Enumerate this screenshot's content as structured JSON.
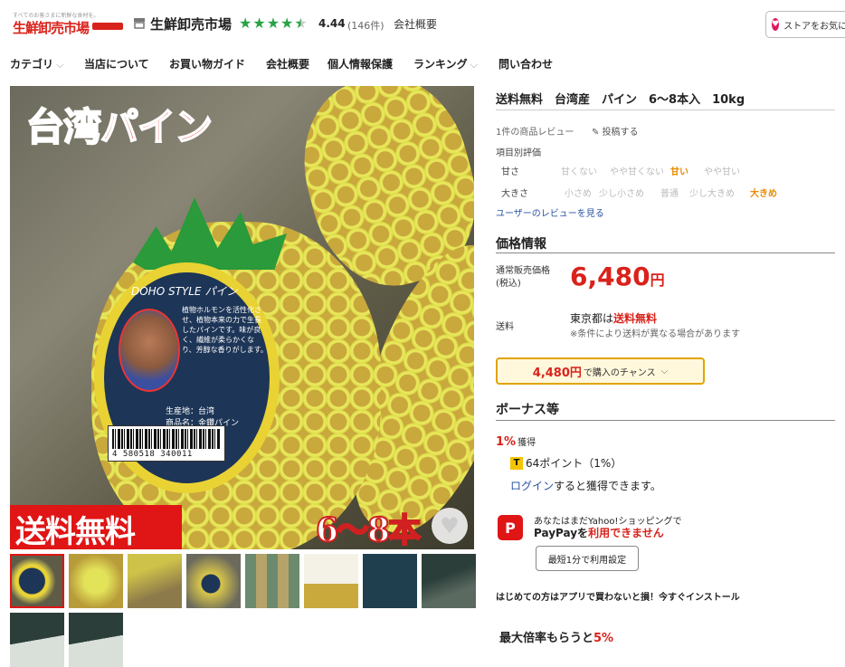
{
  "header": {
    "logo_tagline": "すべてのお客さまに新鮮な食材を。",
    "logo_text": "生鮮卸売市場",
    "store_name": "生鮮卸売市場",
    "rating": "4.44",
    "rating_count": "(146件)",
    "company_overview": "会社概要",
    "favorite_button": "ストアをお気に入り"
  },
  "nav": {
    "category": "カテゴリ",
    "about": "当店について",
    "guide": "お買い物ガイド",
    "overview": "会社概要",
    "privacy": "個人情報保護",
    "ranking": "ランキング",
    "contact": "問い合わせ"
  },
  "image": {
    "title": "台湾パイン",
    "label_title": "DOHO STYLE パイン",
    "label_text": "植物ホルモンを活性化させ、植物本来の力で生長したパインです。味が良く、繊維が柔らかくなり、芳醇な香りがします。",
    "label_origin": "生産地：台湾",
    "label_product": "商品名：金鑽パイン",
    "barcode": "4 580518 340011",
    "shipping_banner": "送料無料",
    "quantity": "6〜8本"
  },
  "product": {
    "title": "送料無料　台湾産　パイン　6〜8本入　10kg",
    "review_count": "1件の商品レビュー",
    "post_review": "投稿する",
    "rating_by_item": "項目別評価",
    "sweetness_label": "甘さ",
    "sweetness_options": [
      "甘くない",
      "やや甘くない",
      "甘い",
      "やや甘い"
    ],
    "size_label": "大きさ",
    "size_options": [
      "小さめ",
      "少し小さめ",
      "普通",
      "少し大きめ",
      "大きめ"
    ],
    "view_reviews": "ユーザーのレビューを見る"
  },
  "price": {
    "section_title": "価格情報",
    "label_line1": "通常販売価格",
    "label_line2": "(税込)",
    "value": "6,480",
    "unit": "円",
    "shipping_label": "送料",
    "shipping_prefix": "東京都は",
    "shipping_value": "送料無料",
    "shipping_note": "※条件により送料が異なる場合があります",
    "chance_price": "4,480円",
    "chance_text": "で購入のチャンス"
  },
  "bonus": {
    "section_title": "ボーナス等",
    "percent": "1%",
    "percent_suffix": "獲得",
    "tpoint": "64ポイント（1%）",
    "login_link": "ログイン",
    "login_text": "すると獲得できます。",
    "paypay_line1": "あなたはまだYahoo!ショッピングで",
    "paypay_line2_prefix": "PayPayを",
    "paypay_line2_red": "利用できません",
    "paypay_button": "最短1分で利用設定",
    "app_promo": "はじめての方はアプリで買わないと損！今すぐインストール",
    "max_rate_prefix": "最大倍率もらうと",
    "max_rate_value": "5%"
  },
  "colors": {
    "accent_red": "#d9221b",
    "star_green": "#29a347",
    "link_blue": "#2952a3",
    "highlight_orange": "#e88a00"
  }
}
